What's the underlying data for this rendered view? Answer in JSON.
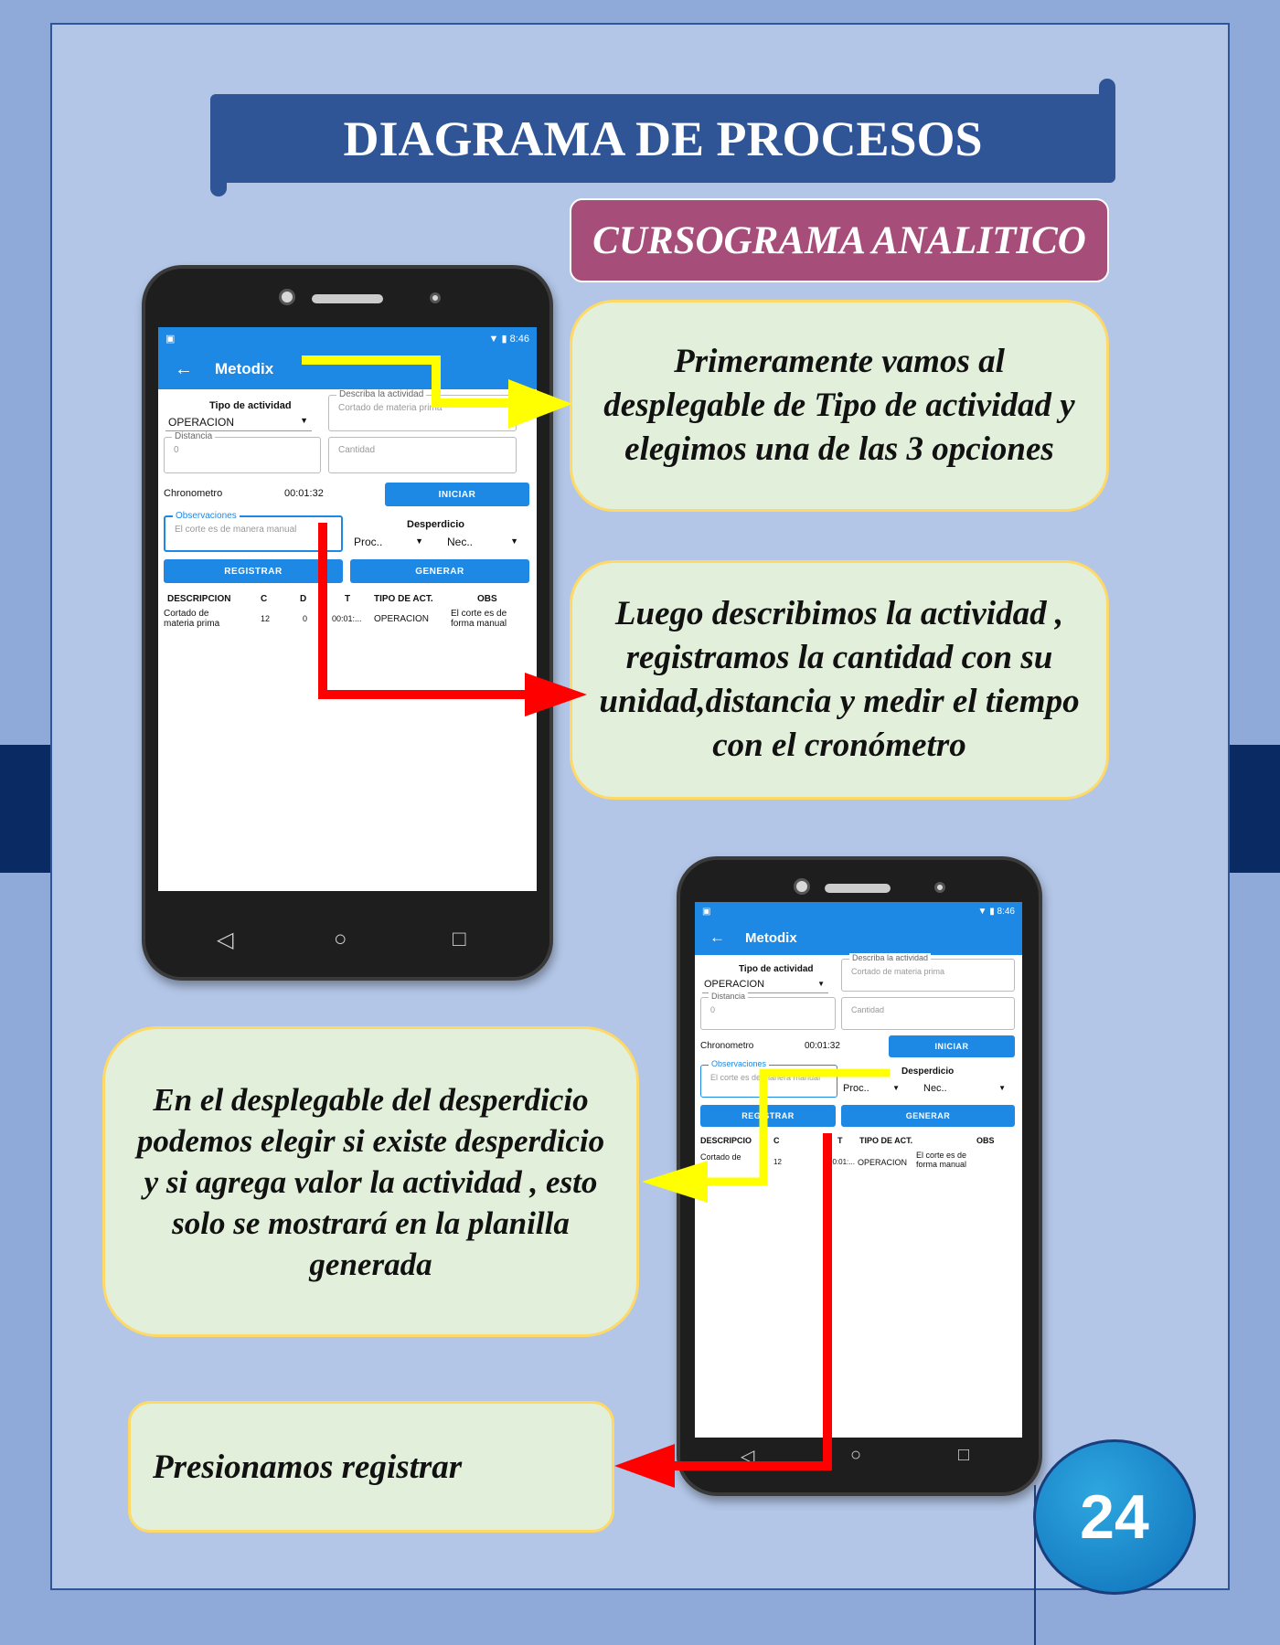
{
  "header": {
    "title": "DIAGRAMA DE PROCESOS",
    "subtitle": "CURSOGRAMA ANALITICO"
  },
  "notes": {
    "step1": "Primeramente vamos al desplegable de Tipo de actividad y elegimos una de las 3 opciones",
    "step2": "Luego describimos la actividad , registramos la cantidad con su unidad,distancia y medir el tiempo con el cronómetro",
    "step3": "En el desplegable del desperdicio podemos elegir si existe desperdicio y si agrega valor la actividad , esto solo se mostrará en la planilla generada",
    "step4": "Presionamos registrar"
  },
  "app": {
    "time": "8:46",
    "back_arrow": "←",
    "title": "Metodix",
    "tipo_label": "Tipo de actividad",
    "tipo_value": "OPERACION",
    "describe_label": "Describa la actividad",
    "describe_placeholder": "Cortado de materia prima",
    "distance_label": "Distancia",
    "distance_placeholder": "0",
    "quantity_placeholder": "Cantidad",
    "chrono_label": "Chronometro",
    "chrono_value": "00:01:32",
    "start_button": "INICIAR",
    "obs_label": "Observaciones",
    "obs_value": "El corte es de manera manual",
    "waste_label": "Desperdicio",
    "proc_value": "Proc..",
    "nec_value": "Nec..",
    "register_button": "REGISTRAR",
    "generate_button": "GENERAR",
    "table_headers": [
      "DESCRIPCION",
      "C",
      "D",
      "T",
      "TIPO DE ACT.",
      "OBS"
    ],
    "table_headers_phone2": [
      "DESCRIPCIO",
      "C",
      "",
      "T",
      "TIPO DE ACT.",
      "OBS"
    ],
    "row": {
      "desc": "Cortado de materia prima",
      "c": "12",
      "d": "0",
      "t": "00:01:...",
      "tipo": "OPERACION",
      "obs": "El corte es de forma manual"
    },
    "row_phone2": {
      "desc": "Cortado de",
      "c": "12",
      "t": "00:01:...",
      "tipo": "OPERACION",
      "obs": "El corte es de forma manual"
    }
  },
  "page_number": "24",
  "colors": {
    "background": "#8fa9d9",
    "page": "#b3c6e7",
    "banner": "#2f5597",
    "subtitle": "#a64d79",
    "note": "#e2efda",
    "note_border": "#ffd966",
    "app_blue": "#1e88e5",
    "arrow_yellow": "#ffff00",
    "arrow_red": "#ff0000"
  },
  "icons": [
    "back-arrow-icon",
    "wifi-icon",
    "battery-icon",
    "dropdown-caret-icon",
    "nav-back-icon",
    "nav-home-icon",
    "nav-recent-icon"
  ]
}
